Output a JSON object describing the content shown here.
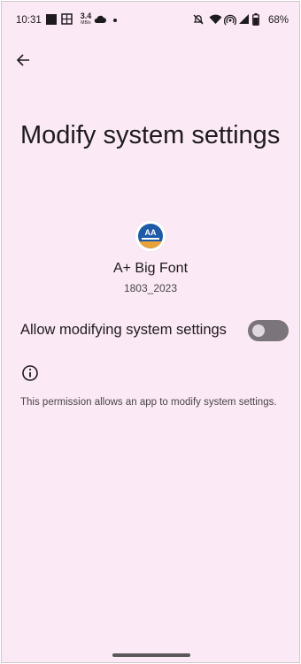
{
  "status_bar": {
    "time": "10:31",
    "net_speed_value": "3.4",
    "net_speed_unit": "MB/s",
    "battery_percent": "68%",
    "icons": [
      "square-notification-icon",
      "gallery-icon",
      "cloud-icon",
      "dot-icon",
      "mute-icon",
      "wifi-icon",
      "hotspot-icon",
      "signal-icon",
      "battery-icon"
    ]
  },
  "header": {
    "back_icon": "arrow-left-icon"
  },
  "page": {
    "title": "Modify system settings"
  },
  "app": {
    "icon": "app-logo-icon",
    "logo_text": "AA",
    "name": "A+ Big Font",
    "version": "1803_2023"
  },
  "setting": {
    "label": "Allow modifying system settings",
    "enabled": false
  },
  "info": {
    "icon": "info-icon",
    "text": "This permission allows an app to modify system settings."
  },
  "colors": {
    "background": "#fbe9f5",
    "toggle_track_off": "#7b747a",
    "toggle_knob_off": "#e0d8de"
  }
}
